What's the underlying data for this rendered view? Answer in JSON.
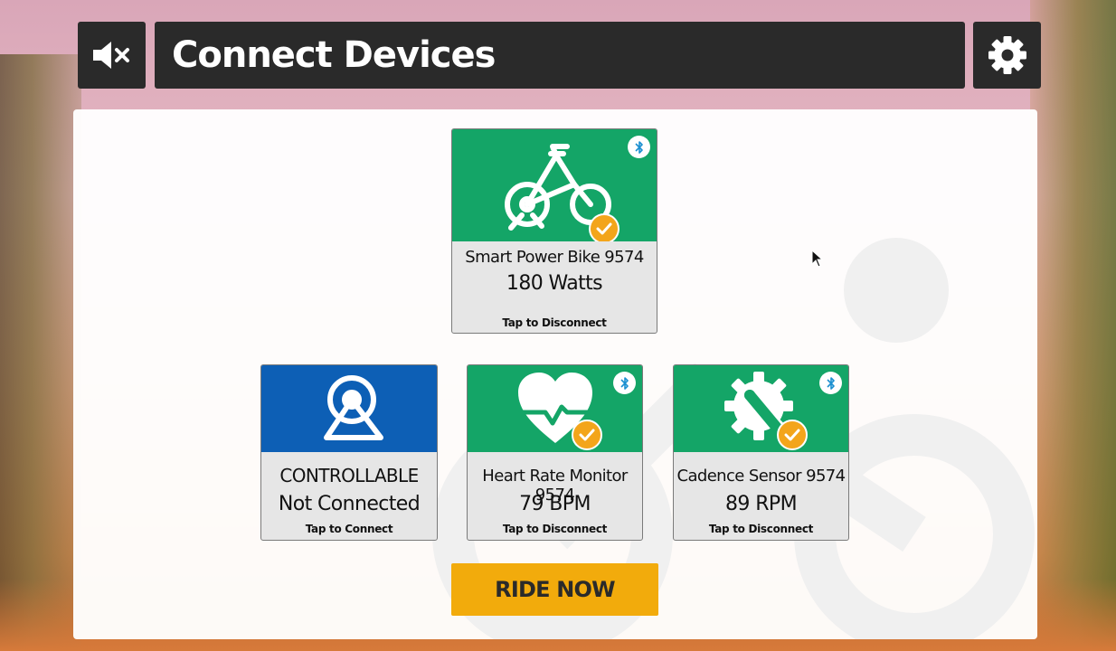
{
  "header": {
    "title": "Connect Devices",
    "mute_icon": "speaker-muted-icon",
    "settings_icon": "gear-icon"
  },
  "devices": {
    "power": {
      "name": "Smart Power Bike 9574",
      "reading": "180 Watts",
      "action": "Tap to Disconnect",
      "icon": "bike-icon",
      "connected": true
    },
    "controllable": {
      "name": "CONTROLLABLE",
      "reading": "Not Connected",
      "action": "Tap to Connect",
      "icon": "trainer-icon",
      "connected": false
    },
    "heart_rate": {
      "name": "Heart Rate Monitor 9574",
      "reading": "79 BPM",
      "action": "Tap to Disconnect",
      "icon": "heart-icon",
      "connected": true
    },
    "cadence": {
      "name": "Cadence Sensor 9574",
      "reading": "89 RPM",
      "action": "Tap to Disconnect",
      "icon": "cadence-gear-icon",
      "connected": true
    }
  },
  "ride_button": {
    "label": "RIDE NOW"
  },
  "colors": {
    "connected_green": "#14a567",
    "controllable_blue": "#0d5fb5",
    "check_orange": "#f3a51b",
    "ride_yellow": "#f2ab0c",
    "header_dark": "#2a2a2a"
  }
}
